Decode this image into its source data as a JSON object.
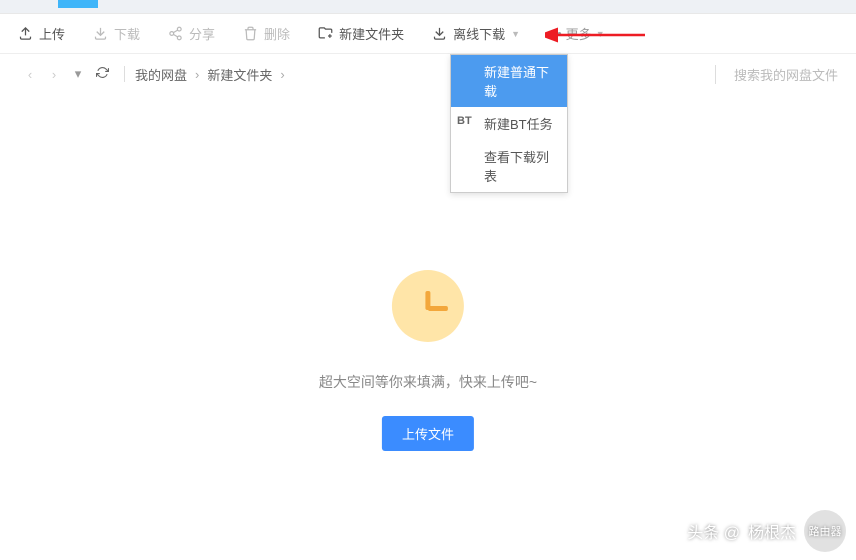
{
  "toolbar": {
    "upload": "上传",
    "download": "下载",
    "share": "分享",
    "delete": "删除",
    "new_folder": "新建文件夹",
    "offline_download": "离线下载",
    "more": "更多"
  },
  "breadcrumb": {
    "root": "我的网盘",
    "folder": "新建文件夹"
  },
  "search": {
    "placeholder": "搜索我的网盘文件"
  },
  "dropdown": {
    "item1": "新建普通下载",
    "item2": "新建BT任务",
    "item2_badge": "BT",
    "item3": "查看下载列表"
  },
  "empty": {
    "message": "超大空间等你来填满，快来上传吧~",
    "button": "上传文件"
  },
  "watermark": {
    "prefix": "头条 @",
    "author": "杨根杰",
    "logo": "路由器"
  }
}
